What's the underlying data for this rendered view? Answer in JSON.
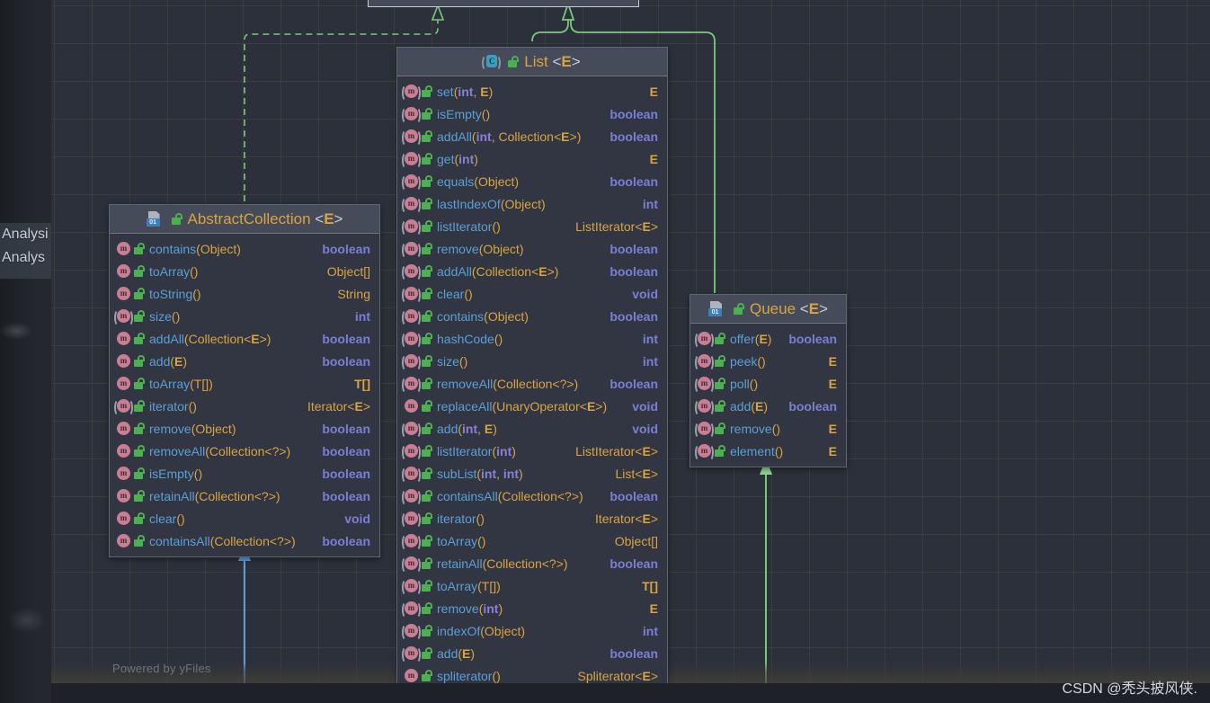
{
  "app": {
    "canvas_watermark": "Powered by yFiles",
    "image_watermark": "CSDN @秃头披风侠.",
    "background_panel_lines": [
      "Analysi",
      "Analys"
    ]
  },
  "colors": {
    "canvas_bg": "#2b303a",
    "node_body": "#313642",
    "node_header": "#454b58",
    "node_border": "#5e6573",
    "title_text": "#d9a441",
    "method_text": "#5c9fd6",
    "param_type": "#d9a441",
    "primitive_keyword": "#8b7fd4",
    "return_primitive": "#7a7fd6",
    "link_green": "#79c97a",
    "link_blue": "#5b9ddb",
    "method_icon": "#c97f93",
    "lock_icon": "#4caf50",
    "interface_icon": "#3c9dbd",
    "class_icon_chip": "#3c7fbd"
  },
  "nodes": [
    {
      "id": "list",
      "name": "List",
      "generic": "<E>",
      "stereotype": "interface",
      "icon": "interface-icon",
      "visibility_icon": "public-unlocked-icon",
      "members": [
        {
          "name": "set",
          "params": "(int, E)",
          "return": "E",
          "return_kind": "E",
          "abstract": true
        },
        {
          "name": "isEmpty",
          "params": "()",
          "return": "boolean",
          "return_kind": "boolean",
          "abstract": true
        },
        {
          "name": "addAll",
          "params": "(int, Collection<E>)",
          "return": "boolean",
          "return_kind": "boolean",
          "abstract": true
        },
        {
          "name": "get",
          "params": "(int)",
          "return": "E",
          "return_kind": "E",
          "abstract": true
        },
        {
          "name": "equals",
          "params": "(Object)",
          "return": "boolean",
          "return_kind": "boolean",
          "abstract": true
        },
        {
          "name": "lastIndexOf",
          "params": "(Object)",
          "return": "int",
          "return_kind": "int",
          "abstract": true
        },
        {
          "name": "listIterator",
          "params": "()",
          "return": "ListIterator<E>",
          "return_kind": "obj",
          "abstract": true
        },
        {
          "name": "remove",
          "params": "(Object)",
          "return": "boolean",
          "return_kind": "boolean",
          "abstract": true
        },
        {
          "name": "addAll",
          "params": "(Collection<E>)",
          "return": "boolean",
          "return_kind": "boolean",
          "abstract": true
        },
        {
          "name": "clear",
          "params": "()",
          "return": "void",
          "return_kind": "void",
          "abstract": true
        },
        {
          "name": "contains",
          "params": "(Object)",
          "return": "boolean",
          "return_kind": "boolean",
          "abstract": true
        },
        {
          "name": "hashCode",
          "params": "()",
          "return": "int",
          "return_kind": "int",
          "abstract": true
        },
        {
          "name": "size",
          "params": "()",
          "return": "int",
          "return_kind": "int",
          "abstract": true
        },
        {
          "name": "removeAll",
          "params": "(Collection<?>)",
          "return": "boolean",
          "return_kind": "boolean",
          "abstract": true
        },
        {
          "name": "replaceAll",
          "params": "(UnaryOperator<E>)",
          "return": "void",
          "return_kind": "void",
          "abstract": false
        },
        {
          "name": "add",
          "params": "(int, E)",
          "return": "void",
          "return_kind": "void",
          "abstract": true
        },
        {
          "name": "listIterator",
          "params": "(int)",
          "return": "ListIterator<E>",
          "return_kind": "obj",
          "abstract": true
        },
        {
          "name": "subList",
          "params": "(int, int)",
          "return": "List<E>",
          "return_kind": "obj",
          "abstract": true
        },
        {
          "name": "containsAll",
          "params": "(Collection<?>)",
          "return": "boolean",
          "return_kind": "boolean",
          "abstract": true
        },
        {
          "name": "iterator",
          "params": "()",
          "return": "Iterator<E>",
          "return_kind": "obj",
          "abstract": true
        },
        {
          "name": "toArray",
          "params": "()",
          "return": "Object[]",
          "return_kind": "obj",
          "abstract": true
        },
        {
          "name": "retainAll",
          "params": "(Collection<?>)",
          "return": "boolean",
          "return_kind": "boolean",
          "abstract": true
        },
        {
          "name": "toArray",
          "params": "(T[])",
          "return": "T[]",
          "return_kind": "T",
          "abstract": true
        },
        {
          "name": "remove",
          "params": "(int)",
          "return": "E",
          "return_kind": "E",
          "abstract": true
        },
        {
          "name": "indexOf",
          "params": "(Object)",
          "return": "int",
          "return_kind": "int",
          "abstract": true
        },
        {
          "name": "add",
          "params": "(E)",
          "return": "boolean",
          "return_kind": "boolean",
          "abstract": true
        },
        {
          "name": "spliterator",
          "params": "()",
          "return": "Spliterator<E>",
          "return_kind": "obj",
          "abstract": false
        }
      ]
    },
    {
      "id": "abstractcollection",
      "name": "AbstractCollection",
      "generic": "<E>",
      "stereotype": "class",
      "icon": "class-icon",
      "visibility_icon": "public-unlocked-icon",
      "members": [
        {
          "name": "contains",
          "params": "(Object)",
          "return": "boolean",
          "return_kind": "boolean",
          "abstract": false
        },
        {
          "name": "toArray",
          "params": "()",
          "return": "Object[]",
          "return_kind": "obj",
          "abstract": false
        },
        {
          "name": "toString",
          "params": "()",
          "return": "String",
          "return_kind": "obj",
          "abstract": false
        },
        {
          "name": "size",
          "params": "()",
          "return": "int",
          "return_kind": "int",
          "abstract": true
        },
        {
          "name": "addAll",
          "params": "(Collection<E>)",
          "return": "boolean",
          "return_kind": "boolean",
          "abstract": false
        },
        {
          "name": "add",
          "params": "(E)",
          "return": "boolean",
          "return_kind": "boolean",
          "abstract": false
        },
        {
          "name": "toArray",
          "params": "(T[])",
          "return": "T[]",
          "return_kind": "T",
          "abstract": false
        },
        {
          "name": "iterator",
          "params": "()",
          "return": "Iterator<E>",
          "return_kind": "obj",
          "abstract": true
        },
        {
          "name": "remove",
          "params": "(Object)",
          "return": "boolean",
          "return_kind": "boolean",
          "abstract": false
        },
        {
          "name": "removeAll",
          "params": "(Collection<?>)",
          "return": "boolean",
          "return_kind": "boolean",
          "abstract": false
        },
        {
          "name": "isEmpty",
          "params": "()",
          "return": "boolean",
          "return_kind": "boolean",
          "abstract": false
        },
        {
          "name": "retainAll",
          "params": "(Collection<?>)",
          "return": "boolean",
          "return_kind": "boolean",
          "abstract": false
        },
        {
          "name": "clear",
          "params": "()",
          "return": "void",
          "return_kind": "void",
          "abstract": false
        },
        {
          "name": "containsAll",
          "params": "(Collection<?>)",
          "return": "boolean",
          "return_kind": "boolean",
          "abstract": false
        }
      ]
    },
    {
      "id": "queue",
      "name": "Queue",
      "generic": "<E>",
      "stereotype": "class",
      "icon": "class-icon",
      "visibility_icon": "public-unlocked-icon",
      "members": [
        {
          "name": "offer",
          "params": "(E)",
          "return": "boolean",
          "return_kind": "boolean",
          "abstract": true
        },
        {
          "name": "peek",
          "params": "()",
          "return": "E",
          "return_kind": "E",
          "abstract": true
        },
        {
          "name": "poll",
          "params": "()",
          "return": "E",
          "return_kind": "E",
          "abstract": true
        },
        {
          "name": "add",
          "params": "(E)",
          "return": "boolean",
          "return_kind": "boolean",
          "abstract": true
        },
        {
          "name": "remove",
          "params": "()",
          "return": "E",
          "return_kind": "E",
          "abstract": true
        },
        {
          "name": "element",
          "params": "()",
          "return": "E",
          "return_kind": "E",
          "abstract": true
        }
      ]
    }
  ],
  "connectors": [
    {
      "id": "abstractcollection-realizes-top",
      "style": "dashed",
      "color": "#79c97a",
      "arrow": "hollow-triangle"
    },
    {
      "id": "list-extends-top",
      "style": "solid",
      "color": "#79c97a",
      "arrow": "hollow-triangle"
    },
    {
      "id": "queue-extends-top",
      "style": "solid",
      "color": "#79c97a",
      "arrow": "hollow-triangle"
    },
    {
      "id": "into-abstractcollection-from-below",
      "style": "solid",
      "color": "#5b9ddb",
      "arrow": "hollow-triangle"
    },
    {
      "id": "into-queue-from-below",
      "style": "solid",
      "color": "#79c97a",
      "arrow": "hollow-triangle"
    }
  ]
}
